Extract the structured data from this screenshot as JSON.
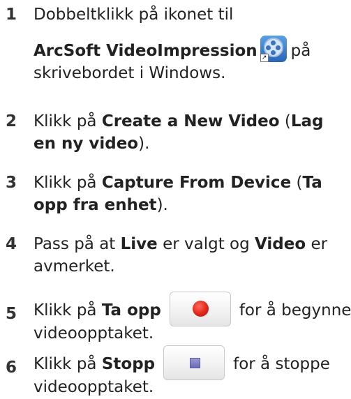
{
  "steps": [
    {
      "number": "1",
      "intro": "Dobbeltklikk på ikonet til",
      "app_name": "ArcSoft VideoImpression",
      "after_icon": "på",
      "line3": "skrivebordet i Windows.",
      "icon": "arcsoft-videoimpression-icon"
    },
    {
      "number": "2",
      "pre": "Klikk på ",
      "bold1": "Create a New Video",
      "mid": " (",
      "bold2a": "Lag",
      "bold2b": "en ny video",
      "post": ")."
    },
    {
      "number": "3",
      "pre": "Klikk på ",
      "bold1": "Capture From Device",
      "mid": " (",
      "bold2a": "Ta",
      "bold2b": "opp fra enhet",
      "post": ")."
    },
    {
      "number": "4",
      "pre": "Pass på at ",
      "bold1": "Live",
      "mid": " er valgt og ",
      "bold2": "Video",
      "post": " er",
      "line2": "avmerket."
    },
    {
      "number": "5",
      "pre": "Klikk på ",
      "bold": "Ta opp",
      "after": "for å begynne",
      "line2": "videoopptaket.",
      "icon": "record-button"
    },
    {
      "number": "6",
      "pre": "Klikk på ",
      "bold": "Stopp",
      "after": "for å stoppe",
      "line2": "videoopptaket.",
      "icon": "stop-button"
    }
  ]
}
